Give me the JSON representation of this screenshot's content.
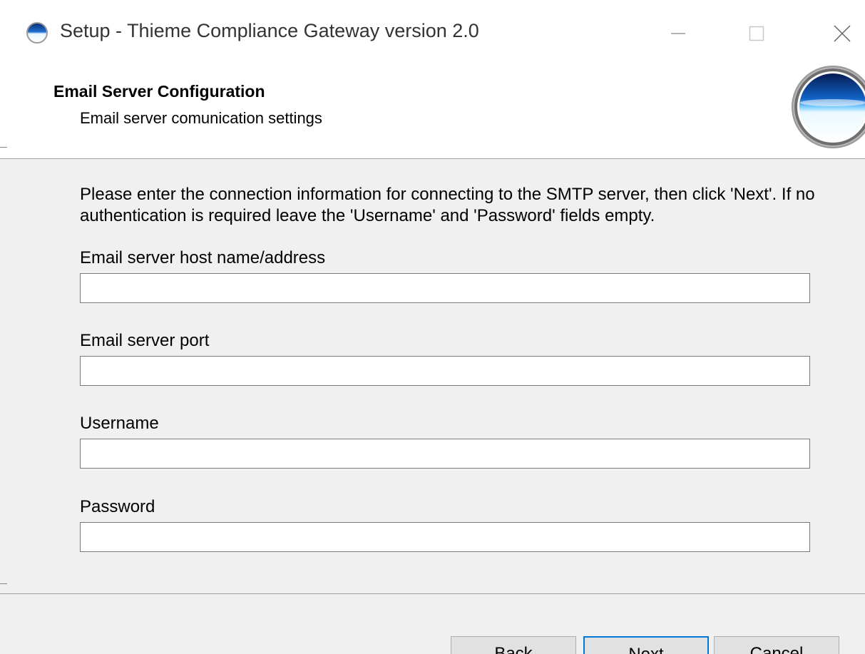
{
  "window": {
    "title": "Setup - Thieme Compliance Gateway version 2.0"
  },
  "header": {
    "title": "Email Server Configuration",
    "subtitle": "Email server comunication settings"
  },
  "instructions": "Please enter the connection information for connecting to the SMTP server, then click 'Next'. If no authentication is required leave the 'Username' and 'Password' fields empty.",
  "fields": [
    {
      "label": "Email server host name/address",
      "value": ""
    },
    {
      "label": "Email server port",
      "value": ""
    },
    {
      "label": "Username",
      "value": ""
    },
    {
      "label": "Password",
      "value": ""
    }
  ],
  "buttons": {
    "back": "Back",
    "next": "Next",
    "cancel": "Cancel"
  },
  "colors": {
    "focus_border": "#0078d7",
    "button_face": "#e1e1e1",
    "panel_background": "#f0f0f0"
  }
}
